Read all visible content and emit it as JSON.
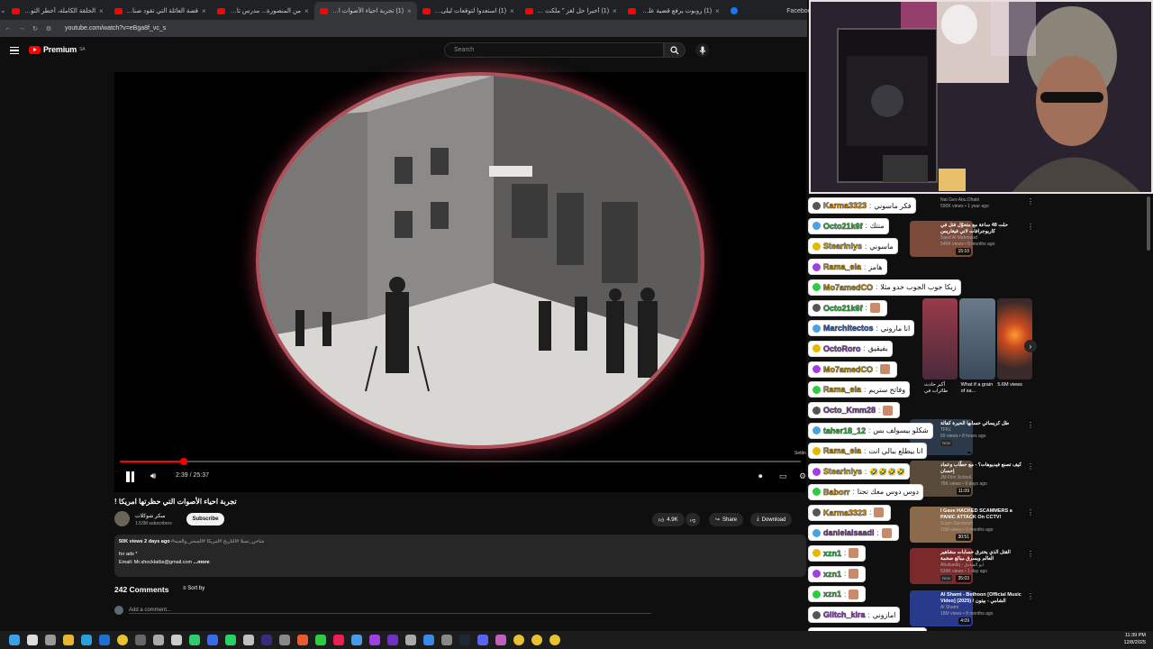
{
  "browser": {
    "tabs": [
      {
        "title": "الحلقة الكاملة، أخطر التوقعات",
        "icon": "youtube-icon"
      },
      {
        "title": "قصة العائلة التي تقود صناعة ال",
        "icon": "youtube-icon"
      },
      {
        "title": "من المنصورة... مدرس تاريخ يغاد",
        "icon": "youtube-icon"
      },
      {
        "title": "(1) تجربة احياء الأصوات التي",
        "icon": "youtube-icon",
        "active": true
      },
      {
        "title": "(1) استعدوا لتوقعات ليلى عبداللـ",
        "icon": "youtube-icon"
      },
      {
        "title": "(1) أخيرا حل لغز \" ملكت برمودا",
        "icon": "youtube-icon"
      },
      {
        "title": "(1) روبوت يرفع قضية على سيد",
        "icon": "youtube-icon"
      },
      {
        "title": "Facebook",
        "icon": "facebook-icon"
      }
    ],
    "url": "youtube.com/watch?v=eBga8f_vc_s"
  },
  "youtube": {
    "logo": "Premium",
    "logo_region": "SA",
    "search_placeholder": "Search"
  },
  "player": {
    "progress": 0.094,
    "time": "2:39 / 25:37",
    "settings_tip": "Settin"
  },
  "video": {
    "title": "تجربة احياء الأصوات التي حظرتها امريكا !",
    "channel": "سكر شوكلات",
    "subscribers": "1.53M subscribers",
    "subscribe_label": "Subscribe",
    "likes": "4.9K",
    "share_label": "Share",
    "download_label": "Download",
    "views_date": "50K views  2 days ago",
    "hashtags": "#شاحن_تسلا  #التاريخ #امريكا  #السحر_والجبة",
    "desc_line1": "for ads *",
    "desc_line2": "Email: Mr.shocklatbs@gmail.com",
    "more_label": "...more",
    "comments_count": "242 Comments",
    "sort_label": "Sort by",
    "add_comment": "Add a comment..."
  },
  "sidebar": [
    {
      "title": "",
      "channel": "Nat Geo Abu Dhabi",
      "meta": "590K views • 1 year ago",
      "duration": ""
    },
    {
      "title": "حلت 48 ساعة مع متحوّل فتل في كاريوجرافات لاني فيغاريس",
      "channel": "Saed Al Mahmood",
      "meta": "546K views • 8 months ago",
      "duration": "15:10"
    },
    {
      "title": "طل كريسائي حسابها الحيرة كفالة",
      "channel": "TFKL",
      "meta": "69 views • 8 hours ago",
      "badge": "New",
      "duration": ""
    },
    {
      "title": "كيف تصنع فيديوهات؟ - مع حطّاب وعماد إحسان",
      "channel": "JM Film School",
      "meta": "78K views • 9 days ago",
      "duration": "11:09"
    },
    {
      "title": "I Gave HACKED SCAMMERS a PANIC ATTACK On CCTV!",
      "channel": "Scam Sandwich",
      "meta": "10M views • 9 months ago",
      "duration": "30:51"
    },
    {
      "title": "القتل الذي يخترق حسابات مشاهير العالم ويسرق مبالغ ضخمة",
      "channel": "Abulsadiq - ابو الصادق",
      "meta": "539K views • 1 day ago",
      "badge": "New",
      "duration": "35:03"
    },
    {
      "title": "Al Shami - Bethoon [Official Music Video] (2025) / الشامي - بيتون",
      "channel": "Al Shami",
      "meta": "18M views • 8 months ago",
      "duration": "4:09"
    }
  ],
  "shorts": [
    {
      "title": "أكبر حادث طائرات في"
    },
    {
      "title": "What if a grain of sa..."
    },
    {
      "title": "5.6M views"
    }
  ],
  "chat": [
    {
      "user": "Karma3323",
      "color": "#f39c12",
      "msg": "فكر ماسوني"
    },
    {
      "user": "Octo21k6f",
      "color": "#2ecc40",
      "msg": "منتك"
    },
    {
      "user": "Stearinlys",
      "color": "#e6b800",
      "msg": "ماسوني"
    },
    {
      "user": "Rama_ela",
      "color": "#d4a017",
      "msg": "هامز"
    },
    {
      "user": "Mo7amedCO",
      "color": "#d4a017",
      "msg": "زبكا جوب الجوب خدو مثلا"
    },
    {
      "user": "Octo21k6f",
      "color": "#2ecc40",
      "msg": ""
    },
    {
      "user": "Marchitectos",
      "color": "#3b6fd8",
      "msg": "انا ماروني"
    },
    {
      "user": "OctoRoro",
      "color": "#a040e0",
      "msg": "يفيقيق"
    },
    {
      "user": "Mo7amedCO",
      "color": "#d4a017",
      "msg": ""
    },
    {
      "user": "Rama_ela",
      "color": "#d4a017",
      "msg": "وفاتح ستريم"
    },
    {
      "user": "Octo_Kmm28",
      "color": "#8e44ad",
      "msg": ""
    },
    {
      "user": "taher18_12",
      "color": "#2ecc40",
      "msg": "شكلو بيسولف بس"
    },
    {
      "user": "Rama_ela",
      "color": "#d4a017",
      "msg": "انا بيطلع ببالي انت"
    },
    {
      "user": "Stearinlys",
      "color": "#e6b800",
      "msg": "🤣🤣🤣🤣"
    },
    {
      "user": "Baborr",
      "color": "#d4a017",
      "msg": "دوس دوس معك تحتا"
    },
    {
      "user": "Karma3323",
      "color": "#f39c12",
      "msg": ""
    },
    {
      "user": "danielalsaadi",
      "color": "#8e44ad",
      "msg": ""
    },
    {
      "user": "xzn1",
      "color": "#2ecc40",
      "msg": ""
    },
    {
      "user": "xzn1",
      "color": "#2ecc40",
      "msg": ""
    },
    {
      "user": "xzn1",
      "color": "#2ecc40",
      "msg": ""
    },
    {
      "user": "Glitch_kira",
      "color": "#a040e0",
      "msg": "امازوني"
    },
    {
      "user": "IZZY_theslayer",
      "color": "#d4a017",
      "msg": "الا الكلسون"
    }
  ],
  "taskbar": {
    "time": "11:39 PM",
    "date": "12/8/2025"
  },
  "colors": {
    "accent": "#ff0000",
    "bg": "#0f0f0f",
    "chip": "#272727"
  }
}
